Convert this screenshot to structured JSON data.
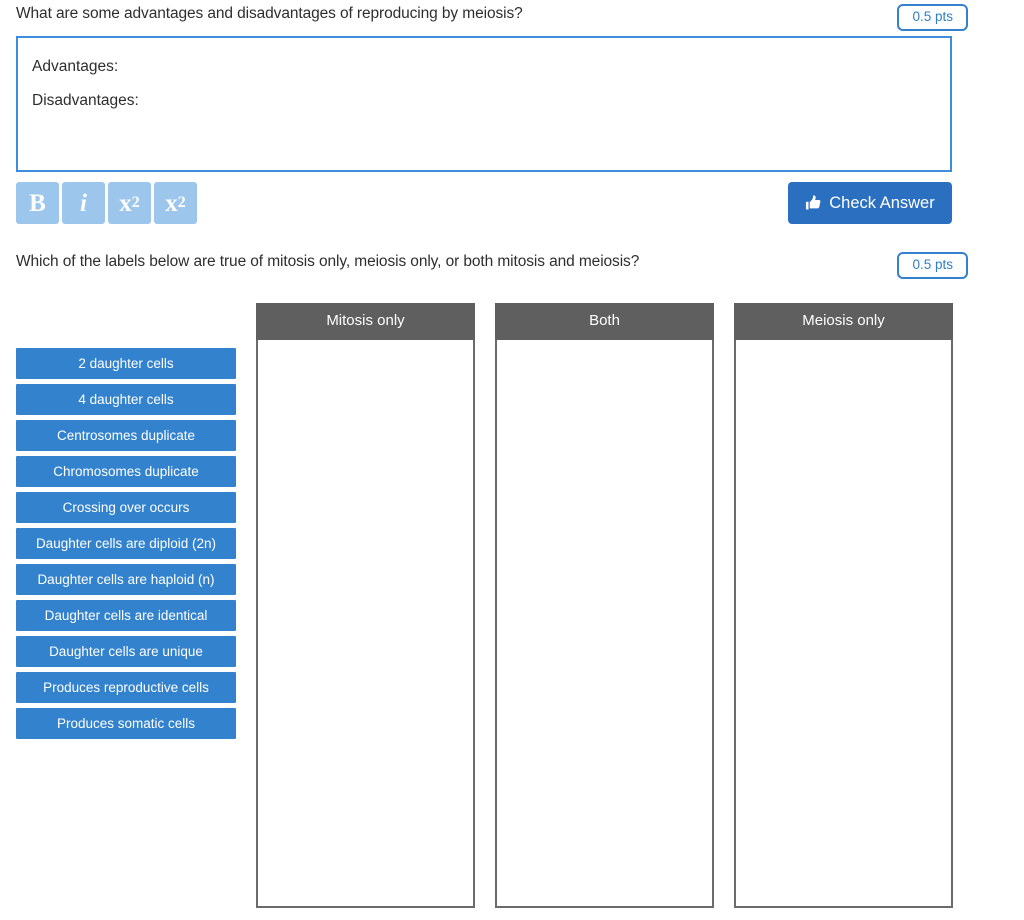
{
  "questions": [
    {
      "text": "What are some advantages and disadvantages of reproducing by meiosis?",
      "points": "0.5 pts"
    },
    {
      "text": "Which of the labels below are true of mitosis only, meiosis only, or both mitosis and meiosis?",
      "points": "0.5 pts"
    }
  ],
  "answer_box": {
    "value": "Advantages:\nDisadvantages:",
    "placeholder": ""
  },
  "format_toolbar": [
    {
      "name": "bold",
      "label": "B"
    },
    {
      "name": "italic",
      "label": "i"
    },
    {
      "name": "subscript",
      "base": "x",
      "script": "2"
    },
    {
      "name": "superscript",
      "base": "x",
      "script": "2"
    }
  ],
  "check_answer": {
    "label": "Check Answer",
    "icon": "thumbs-up-icon"
  },
  "drag_drop": {
    "labels": [
      "2 daughter cells",
      "4 daughter cells",
      "Centrosomes duplicate",
      "Chromosomes duplicate",
      "Crossing over occurs",
      "Daughter cells are diploid (2n)",
      "Daughter cells are haploid (n)",
      "Daughter cells are identical",
      "Daughter cells are unique",
      "Produces reproductive cells",
      "Produces somatic cells"
    ],
    "columns": [
      {
        "title": "Mitosis only",
        "items": []
      },
      {
        "title": "Both",
        "items": []
      },
      {
        "title": "Meiosis only",
        "items": []
      }
    ]
  },
  "colors": {
    "label_blue": "#3382ce",
    "toolbar_blue": "#9dc6ec",
    "button_blue": "#2a6fc0",
    "border_blue": "#3c8dde",
    "header_gray": "#5f5f5f"
  }
}
